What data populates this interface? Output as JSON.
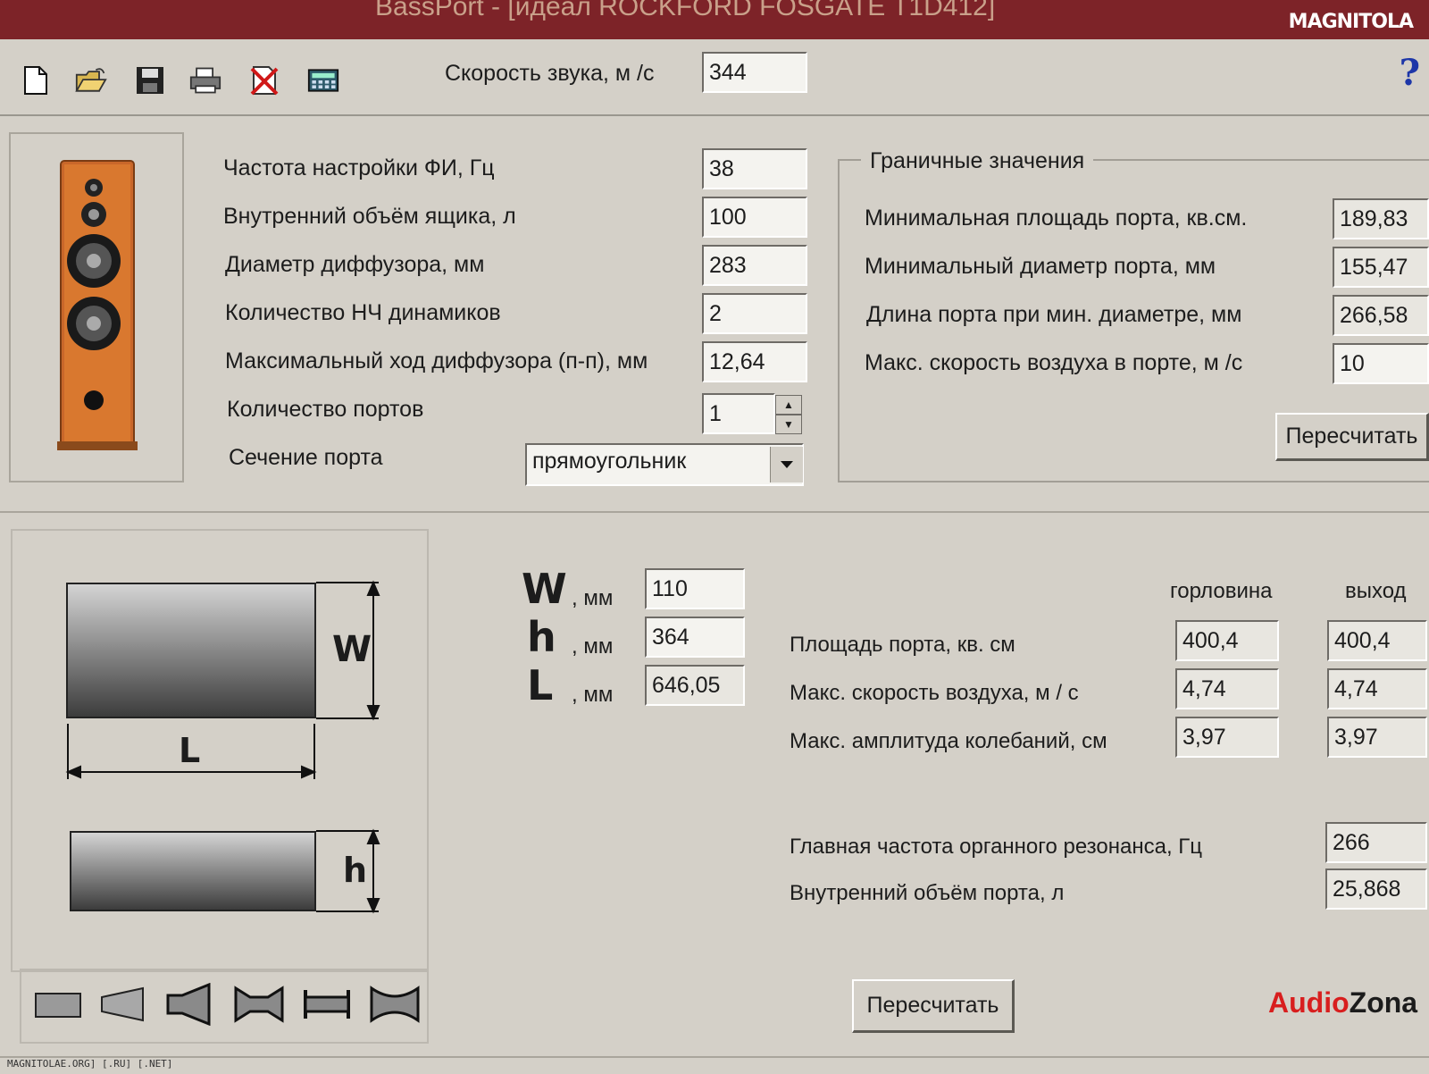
{
  "window": {
    "title": "BassPort - [идеал ROCKFORD FOSGATE T1D412]",
    "watermark": "MAGNITOLA"
  },
  "toolbar": {
    "icons": [
      "new-file-icon",
      "open-folder-icon",
      "save-disk-icon",
      "print-icon",
      "delete-icon",
      "calculator-icon"
    ],
    "sound_speed_label": "Скорость звука, м /с",
    "sound_speed_value": "344",
    "help": "?"
  },
  "main": {
    "tuning_freq_label": "Частота настройки ФИ, Гц",
    "tuning_freq_value": "38",
    "box_volume_label": "Внутренний объём ящика, л",
    "box_volume_value": "100",
    "cone_diameter_label": "Диаметр диффузора, мм",
    "cone_diameter_value": "283",
    "woofer_count_label": "Количество НЧ динамиков",
    "woofer_count_value": "2",
    "max_excursion_label": "Максимальный ход диффузора (п-п), мм",
    "max_excursion_value": "12,64",
    "port_count_label": "Количество портов",
    "port_count_value": "1",
    "port_section_label": "Сечение порта",
    "port_section_value": "прямоугольник"
  },
  "limits": {
    "title": "Граничные значения",
    "min_area_label": "Минимальная площадь порта, кв.см.",
    "min_area_value": "189,83",
    "min_diameter_label": "Минимальный диаметр порта, мм",
    "min_diameter_value": "155,47",
    "port_length_label": "Длина порта при мин. диаметре, мм",
    "port_length_value": "266,58",
    "max_air_speed_label": "Макс. скорость воздуха в порте, м /с",
    "max_air_speed_value": "10",
    "recalc_label": "Пересчитать"
  },
  "dimensions": {
    "w_letter": "W",
    "h_letter": "h",
    "l_letter": "L",
    "unit": ", мм",
    "w_value": "110",
    "h_value": "364",
    "l_value": "646,05",
    "diagram_w": "W",
    "diagram_l": "L",
    "diagram_h": "h"
  },
  "results": {
    "col_throat": "горловина",
    "col_exit": "выход",
    "port_area_label": "Площадь порта, кв. см",
    "port_area_throat": "400,4",
    "port_area_exit": "400,4",
    "max_air_speed_label": "Макс. скорость воздуха, м / с",
    "max_air_speed_throat": "4,74",
    "max_air_speed_exit": "4,74",
    "max_amplitude_label": "Макс. амплитуда колебаний, см",
    "max_amplitude_throat": "3,97",
    "max_amplitude_exit": "3,97",
    "organ_resonance_label": "Главная частота органного резонанса, Гц",
    "organ_resonance_value": "266",
    "port_volume_label": "Внутренний объём порта, л",
    "port_volume_value": "25,868"
  },
  "footer": {
    "recalc_label": "Пересчитать",
    "brand_audio": "Audio",
    "brand_zona": "Zona",
    "brand_audio_color": "#d81e1e",
    "brand_zona_color": "#1c1c1c",
    "status": "MAGNITOLAE.ORG] [.RU] [.NET]",
    "shape_icons": [
      "rect-port-icon",
      "cone-port-icon",
      "flared-exit-icon",
      "double-flare-icon",
      "straight-tube-icon",
      "hourglass-port-icon"
    ]
  }
}
